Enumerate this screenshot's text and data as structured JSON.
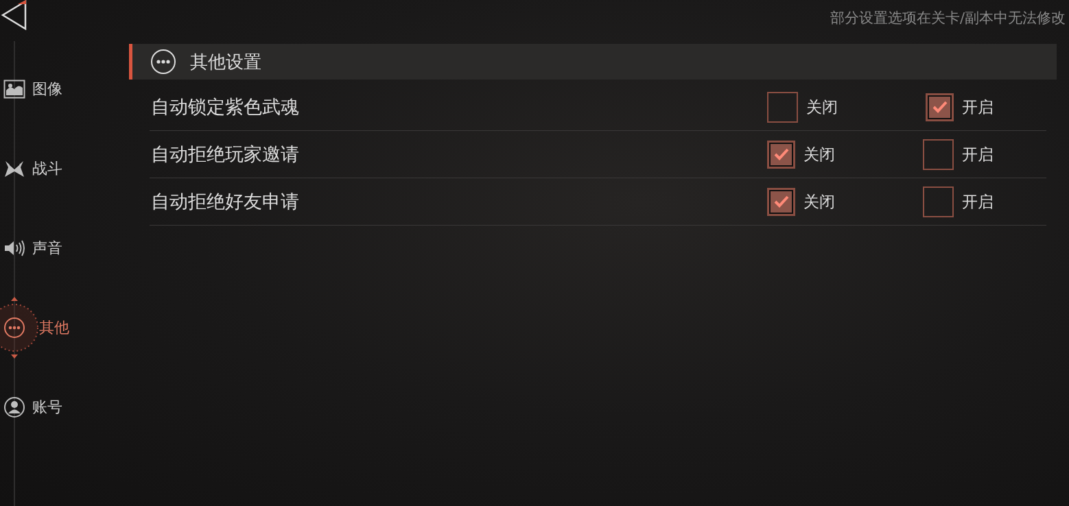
{
  "notice": "部分设置选项在关卡/副本中无法修改",
  "sidebar": {
    "items": [
      {
        "kind": "image",
        "label": "图像",
        "selected": false
      },
      {
        "kind": "combat",
        "label": "战斗",
        "selected": false
      },
      {
        "kind": "sound",
        "label": "声音",
        "selected": false
      },
      {
        "kind": "more",
        "label": "其他",
        "selected": true
      },
      {
        "kind": "account",
        "label": "账号",
        "selected": false
      }
    ]
  },
  "section": {
    "title": "其他设置",
    "rows": [
      {
        "label": "自动锁定紫色武魂",
        "options": [
          {
            "label": "关闭",
            "checked": false
          },
          {
            "label": "开启",
            "checked": true
          }
        ]
      },
      {
        "label": "自动拒绝玩家邀请",
        "options": [
          {
            "label": "关闭",
            "checked": true
          },
          {
            "label": "开启",
            "checked": false
          }
        ]
      },
      {
        "label": "自动拒绝好友申请",
        "options": [
          {
            "label": "关闭",
            "checked": true
          },
          {
            "label": "开启",
            "checked": false
          }
        ]
      }
    ]
  }
}
